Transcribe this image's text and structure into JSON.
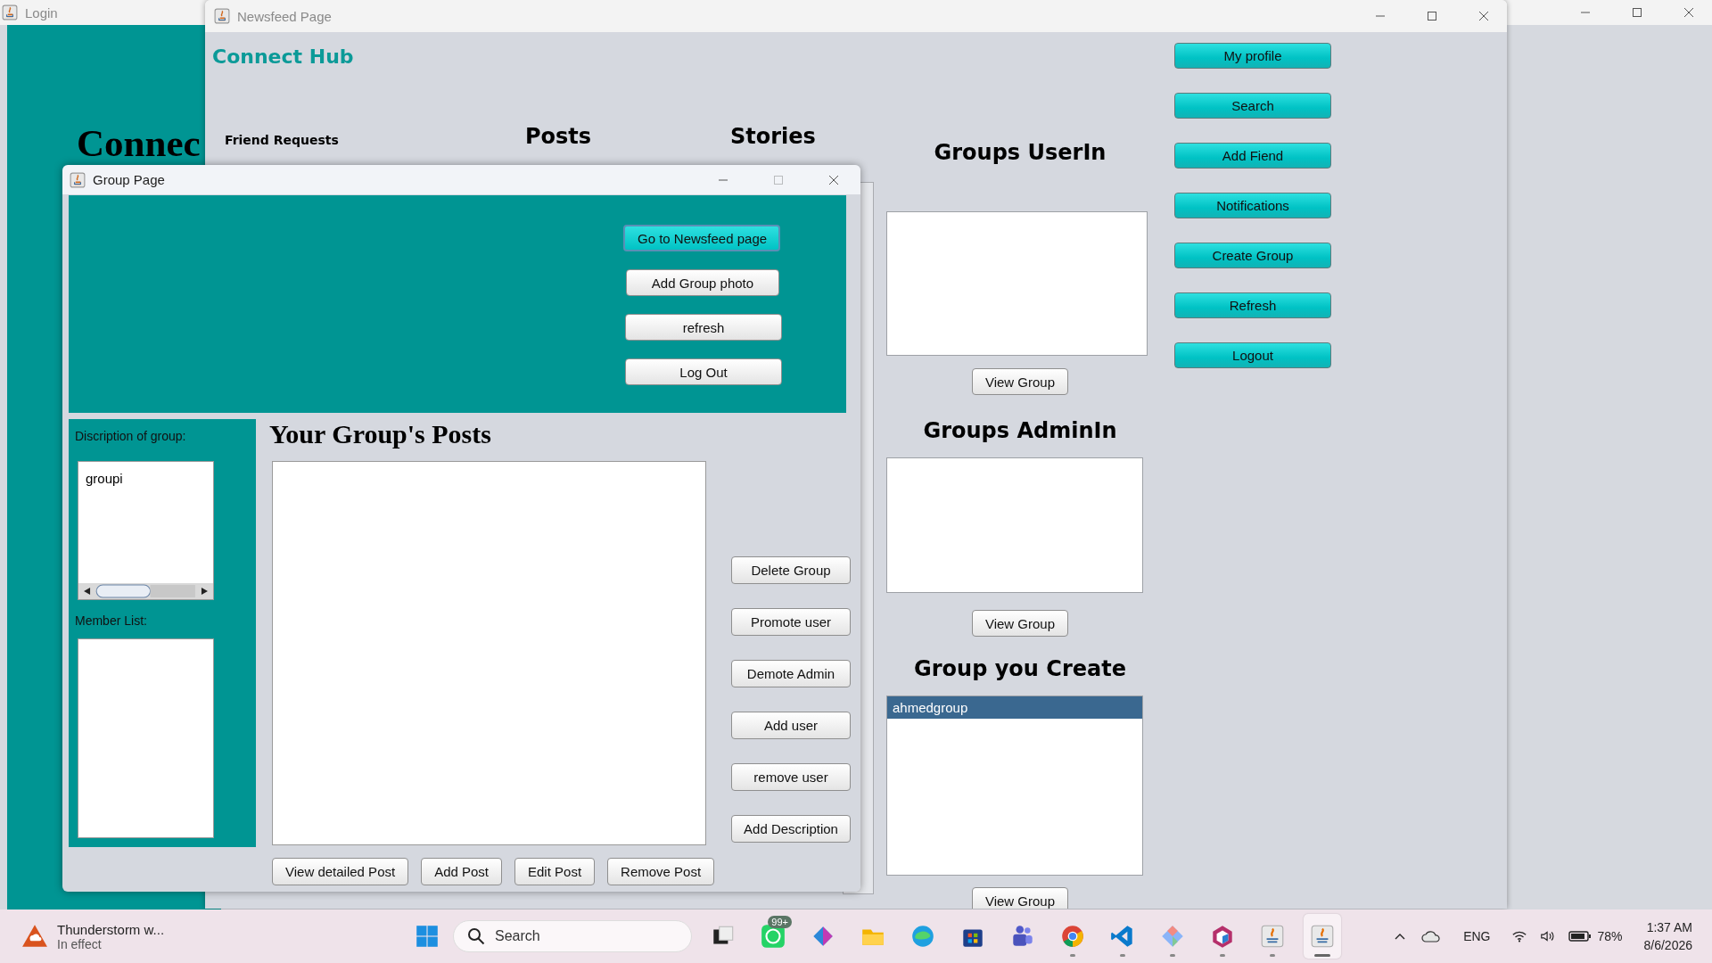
{
  "login_window": {
    "title": "Login",
    "heading": "Connec"
  },
  "newsfeed_window": {
    "title": "Newsfeed Page",
    "brand": "Connect Hub",
    "section_titles": [
      "Friend Requests",
      "Posts",
      "Stories"
    ],
    "group_lists": [
      {
        "title": "Groups UserIn",
        "button": "View Group"
      },
      {
        "title": "Groups AdminIn",
        "button": "View Group"
      },
      {
        "title": "Group you Create",
        "items": [
          {
            "label": "ahmedgroup",
            "selected": true
          }
        ],
        "button": "View Group"
      }
    ],
    "nav_buttons": [
      "My profile",
      "Search",
      "Add Fiend",
      "Notifications",
      "Create Group",
      "Refresh",
      "Logout"
    ]
  },
  "group_window": {
    "title": "Group Page",
    "header_buttons": [
      {
        "label": "Go to Newsfeed page",
        "focused": true
      },
      {
        "label": "Add Group photo",
        "focused": false
      },
      {
        "label": "refresh",
        "focused": false
      },
      {
        "label": "Log Out",
        "focused": false
      }
    ],
    "description_label": "Discription of group:",
    "description_value": "groupi",
    "member_label": "Member List:",
    "posts_title": "Your Group's Posts",
    "side_buttons": [
      "Delete Group",
      "Promote user",
      "Demote Admin",
      "Add user",
      "remove user",
      "Add Description"
    ],
    "bottom_buttons": [
      "View detailed Post",
      "Add Post",
      "Edit Post",
      "Remove Post"
    ]
  },
  "taskbar": {
    "weather": {
      "title": "Thunderstorm w...",
      "subtitle": "In effect"
    },
    "search": {
      "placeholder": "Search"
    },
    "apps": [
      {
        "kind": "task-view",
        "running": false,
        "active": false
      },
      {
        "kind": "chat",
        "running": false,
        "active": false,
        "badge": "99+"
      },
      {
        "kind": "office",
        "running": false,
        "active": false
      },
      {
        "kind": "folder",
        "running": false,
        "active": false
      },
      {
        "kind": "browser-edge",
        "running": false,
        "active": false
      },
      {
        "kind": "store",
        "running": false,
        "active": false
      },
      {
        "kind": "teams",
        "running": false,
        "active": false
      },
      {
        "kind": "chrome",
        "running": true,
        "active": false
      },
      {
        "kind": "code",
        "running": true,
        "active": false
      },
      {
        "kind": "gem",
        "running": true,
        "active": false
      },
      {
        "kind": "cube",
        "running": true,
        "active": false
      },
      {
        "kind": "java",
        "running": true,
        "active": false
      },
      {
        "kind": "java",
        "running": true,
        "active": true
      }
    ],
    "tray": {
      "language": "ENG",
      "battery": "78%",
      "time": "1:37 AM",
      "date": "8/6/2026"
    }
  }
}
